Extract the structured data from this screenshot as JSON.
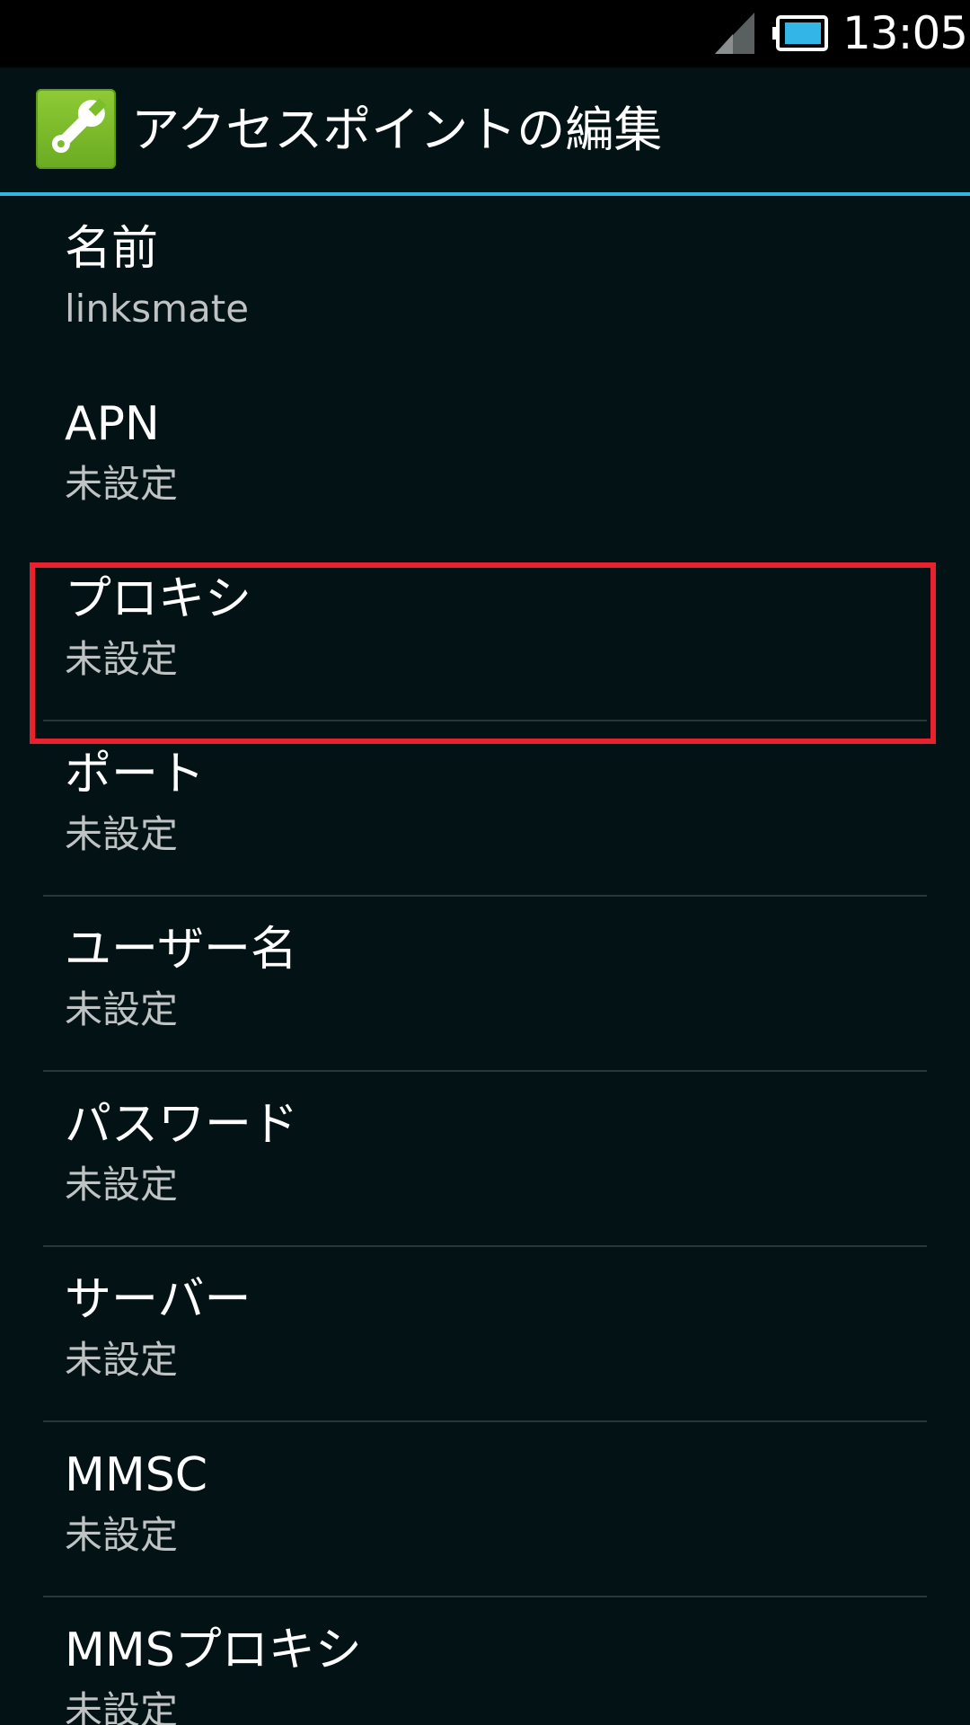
{
  "status_bar": {
    "time": "13:05",
    "icons": [
      "signal-icon",
      "battery-icon"
    ]
  },
  "action_bar": {
    "title": "アクセスポイントの編集",
    "icon": "wrench-icon",
    "accent_color": "#33b5e5"
  },
  "items": [
    {
      "title": "名前",
      "summary": "linksmate"
    },
    {
      "title": "APN",
      "summary": "未設定",
      "highlighted": true
    },
    {
      "title": "プロキシ",
      "summary": "未設定"
    },
    {
      "title": "ポート",
      "summary": "未設定"
    },
    {
      "title": "ユーザー名",
      "summary": "未設定"
    },
    {
      "title": "パスワード",
      "summary": "未設定"
    },
    {
      "title": "サーバー",
      "summary": "未設定"
    },
    {
      "title": "MMSC",
      "summary": "未設定"
    },
    {
      "title": "MMSプロキシ",
      "summary": "未設定"
    }
  ],
  "highlight_color": "#e8212e"
}
